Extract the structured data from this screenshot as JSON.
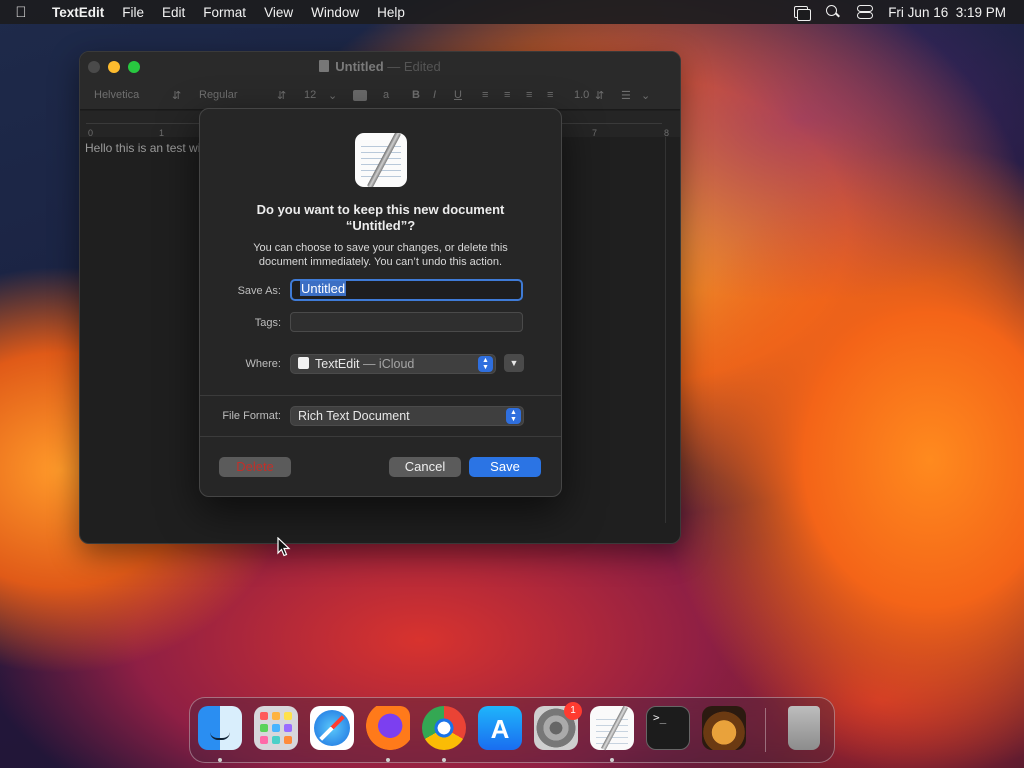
{
  "menubar": {
    "app_name": "TextEdit",
    "menus": [
      "File",
      "Edit",
      "Format",
      "View",
      "Window",
      "Help"
    ],
    "clock": "Fri Jun 16  3:19 PM"
  },
  "window": {
    "title": "Untitled",
    "title_status": "— Edited",
    "toolbar": {
      "font_family": "Helvetica",
      "font_style": "Regular",
      "font_size": "12",
      "line_spacing": "1.0"
    },
    "ruler": {
      "marks": [
        "0",
        "1",
        "7",
        "8"
      ]
    },
    "document_text": "Hello this is an test wi"
  },
  "dialog": {
    "heading_line1": "Do you want to keep this new document",
    "heading_line2": "“Untitled”?",
    "body_line1": "You can choose to save your changes, or delete this",
    "body_line2": "document immediately. You can’t undo this action.",
    "save_as_label": "Save As:",
    "save_as_value": "Untitled",
    "tags_label": "Tags:",
    "tags_value": "",
    "where_label": "Where:",
    "where_value": "TextEdit",
    "where_suffix": "— iCloud",
    "file_format_label": "File Format:",
    "file_format_value": "Rich Text Document",
    "delete_label": "Delete",
    "cancel_label": "Cancel",
    "save_label": "Save"
  },
  "dock": {
    "items": [
      "Finder",
      "Launchpad",
      "Safari",
      "Firefox",
      "Chrome",
      "App Store",
      "System Settings",
      "TextEdit",
      "Terminal",
      "GarageBand",
      "Trash"
    ],
    "settings_badge": "1"
  },
  "colors": {
    "accent_blue": "#2b74e4",
    "delete_red": "#c0302a"
  }
}
